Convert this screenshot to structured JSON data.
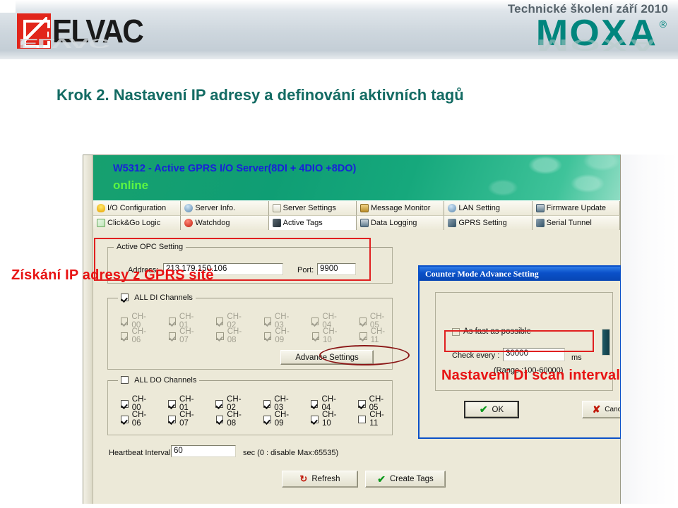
{
  "banner": {
    "training_label": "Technické školení září 2010",
    "elvac_logo_text": "ELVAC",
    "moxa_logo_text": "MOXA",
    "moxa_registered": "®",
    "moxa_color": "#00857d",
    "elvac_mark_color": "#e1251b"
  },
  "slide": {
    "title": "Krok 2. Nastavení IP adresy a definování aktivních tagů",
    "title_color": "#136b63"
  },
  "annotations": {
    "left": "Získání IP adresy z GPRS sítě",
    "right": "Nastavení DI scan intervalu",
    "color": "#e81313"
  },
  "app": {
    "header": {
      "device_title": "W5312 - Active GPRS I/O Server(8DI + 4DIO +8DO)",
      "status": "online",
      "title_color": "#1822d8",
      "status_color": "#5cf542",
      "background_color": "#16a87c"
    },
    "toolbar": {
      "row1": [
        {
          "label": "I/O Configuration",
          "icon": "bulb-icon",
          "active": false
        },
        {
          "label": "Server Info.",
          "icon": "info-icon",
          "active": false
        },
        {
          "label": "Server Settings",
          "icon": "document-icon",
          "active": false
        },
        {
          "label": "Message Monitor",
          "icon": "mail-icon",
          "active": false
        },
        {
          "label": "LAN Setting",
          "icon": "info-icon",
          "active": false
        },
        {
          "label": "Firmware Update",
          "icon": "computer-icon",
          "active": false
        }
      ],
      "row2": [
        {
          "label": "Click&Go Logic",
          "icon": "check-icon",
          "active": false
        },
        {
          "label": "Watchdog",
          "icon": "ball-icon",
          "active": false
        },
        {
          "label": "Active Tags",
          "icon": "tag-icon",
          "active": true
        },
        {
          "label": "Data Logging",
          "icon": "computer-icon",
          "active": false
        },
        {
          "label": "GPRS Setting",
          "icon": "network-icon",
          "active": false
        },
        {
          "label": "Serial Tunnel",
          "icon": "network-icon",
          "active": false
        }
      ]
    },
    "opc": {
      "group_label": "Active OPC Setting",
      "address_label": "Address:",
      "address_value": "213.179.150.106",
      "port_label": "Port:",
      "port_value": "9900"
    },
    "di": {
      "group_label": "ALL DI Channels",
      "group_checked": true,
      "disabled": true,
      "channels": [
        {
          "label": "CH-00",
          "checked": true
        },
        {
          "label": "CH-01",
          "checked": true
        },
        {
          "label": "CH-02",
          "checked": true
        },
        {
          "label": "CH-03",
          "checked": true
        },
        {
          "label": "CH-04",
          "checked": true
        },
        {
          "label": "CH-05",
          "checked": true
        },
        {
          "label": "CH-06",
          "checked": true
        },
        {
          "label": "CH-07",
          "checked": true
        },
        {
          "label": "CH-08",
          "checked": true
        },
        {
          "label": "CH-09",
          "checked": true
        },
        {
          "label": "CH-10",
          "checked": true
        },
        {
          "label": "CH-11",
          "checked": true
        }
      ],
      "advance_button": "Advance Settings"
    },
    "do": {
      "group_label": "ALL DO Channels",
      "group_checked": false,
      "channels": [
        {
          "label": "CH-00",
          "checked": true
        },
        {
          "label": "CH-01",
          "checked": true
        },
        {
          "label": "CH-02",
          "checked": true
        },
        {
          "label": "CH-03",
          "checked": true
        },
        {
          "label": "CH-04",
          "checked": true
        },
        {
          "label": "CH-05",
          "checked": true
        },
        {
          "label": "CH-06",
          "checked": true
        },
        {
          "label": "CH-07",
          "checked": true
        },
        {
          "label": "CH-08",
          "checked": true
        },
        {
          "label": "CH-09",
          "checked": true
        },
        {
          "label": "CH-10",
          "checked": true
        },
        {
          "label": "CH-11",
          "checked": false
        }
      ]
    },
    "heartbeat": {
      "label": "Heartbeat Interval :",
      "value": "60",
      "hint": "sec (0 : disable  Max:65535)"
    },
    "footer_buttons": {
      "refresh": "Refresh",
      "create_tags": "Create Tags"
    }
  },
  "dialog": {
    "title": "Counter Mode Advance Setting",
    "as_fast_label": "As fast as possible",
    "as_fast_checked": false,
    "check_every_label": "Check every :",
    "check_every_value": "30000",
    "unit": "ms",
    "range_hint": "(Range :100-60000)",
    "ok_label": "OK",
    "cancel_label": "Cancel"
  }
}
